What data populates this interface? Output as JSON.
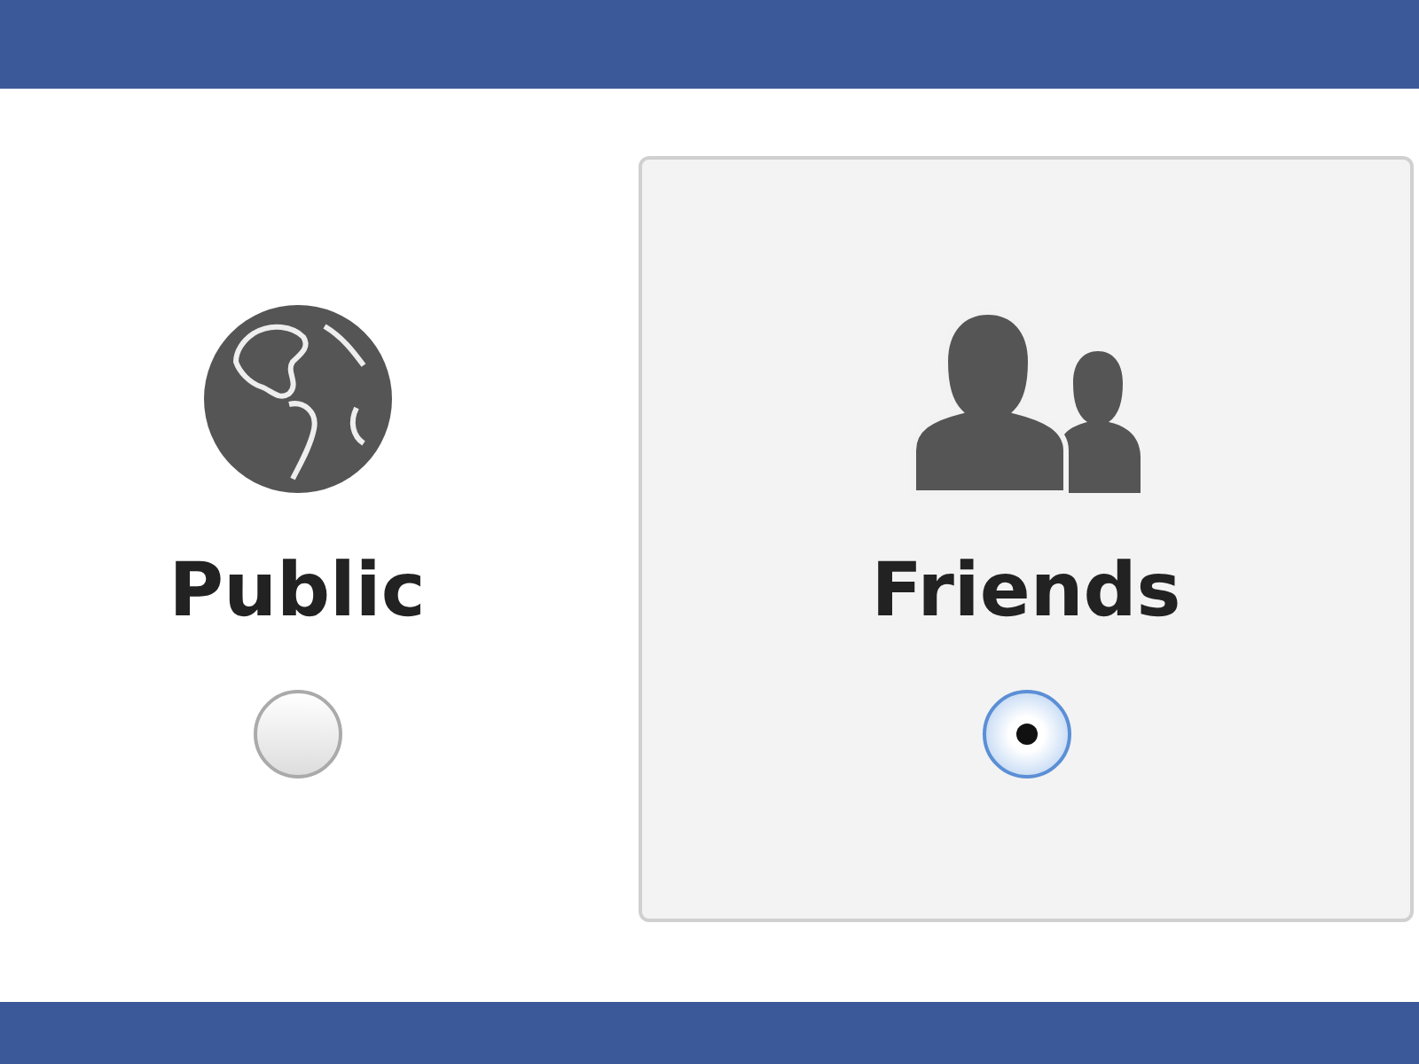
{
  "options": [
    {
      "kind": "globe",
      "label": "Public",
      "selected": false
    },
    {
      "kind": "friends",
      "label": "Friends",
      "selected": true
    }
  ]
}
